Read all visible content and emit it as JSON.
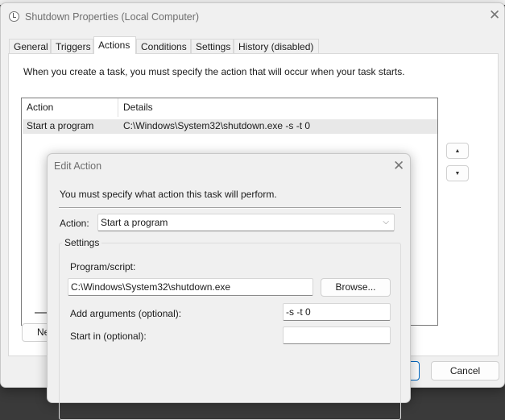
{
  "window": {
    "title": "Shutdown Properties (Local Computer)"
  },
  "tabs": [
    "General",
    "Triggers",
    "Actions",
    "Conditions",
    "Settings",
    "History (disabled)"
  ],
  "actions_tab": {
    "description": "When you create a task, you must specify the action that will occur when your task starts.",
    "columns": [
      "Action",
      "Details"
    ],
    "rows": [
      {
        "action": "Start a program",
        "details": "C:\\Windows\\System32\\shutdown.exe -s -t 0"
      }
    ],
    "new_button": "Ne"
  },
  "footer": {
    "cancel": "Cancel"
  },
  "edit_action": {
    "title": "Edit Action",
    "instruction": "You must specify what action this task will perform.",
    "action_label": "Action:",
    "action_value": "Start a program",
    "settings_label": "Settings",
    "program_label": "Program/script:",
    "program_value": "C:\\Windows\\System32\\shutdown.exe",
    "browse": "Browse...",
    "args_label": "Add arguments (optional):",
    "args_value": "-s -t 0",
    "startin_label": "Start in (optional):",
    "startin_value": ""
  }
}
